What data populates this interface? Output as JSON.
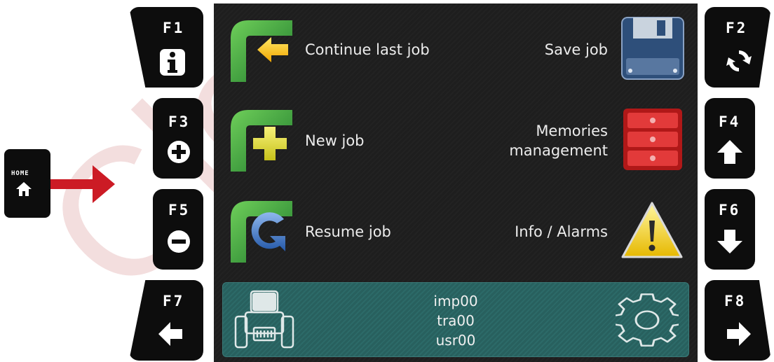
{
  "watermark": "Cle",
  "home_key": {
    "label": "HOME",
    "icon": "home-icon"
  },
  "fkeys": {
    "f1": {
      "label": "F1",
      "icon": "info-icon"
    },
    "f2": {
      "label": "F2",
      "icon": "refresh-icon"
    },
    "f3": {
      "label": "F3",
      "icon": "plus-icon"
    },
    "f4": {
      "label": "F4",
      "icon": "arrow-up-icon"
    },
    "f5": {
      "label": "F5",
      "icon": "minus-icon"
    },
    "f6": {
      "label": "F6",
      "icon": "arrow-down-icon"
    },
    "f7": {
      "label": "F7",
      "icon": "arrow-left-icon"
    },
    "f8": {
      "label": "F8",
      "icon": "arrow-right-icon"
    }
  },
  "menu": {
    "continue_last_job": "Continue last job",
    "save_job": "Save job",
    "new_job": "New job",
    "memories_line1": "Memories",
    "memories_line2": "management",
    "resume_job": "Resume job",
    "info_alarms": "Info / Alarms"
  },
  "status": {
    "implement": "imp00",
    "tractor": "tra00",
    "user": "usr00"
  },
  "colors": {
    "accent_arrow": "#cc1b25",
    "status_bar": "#2c6a68",
    "screen_bg": "#222222"
  }
}
